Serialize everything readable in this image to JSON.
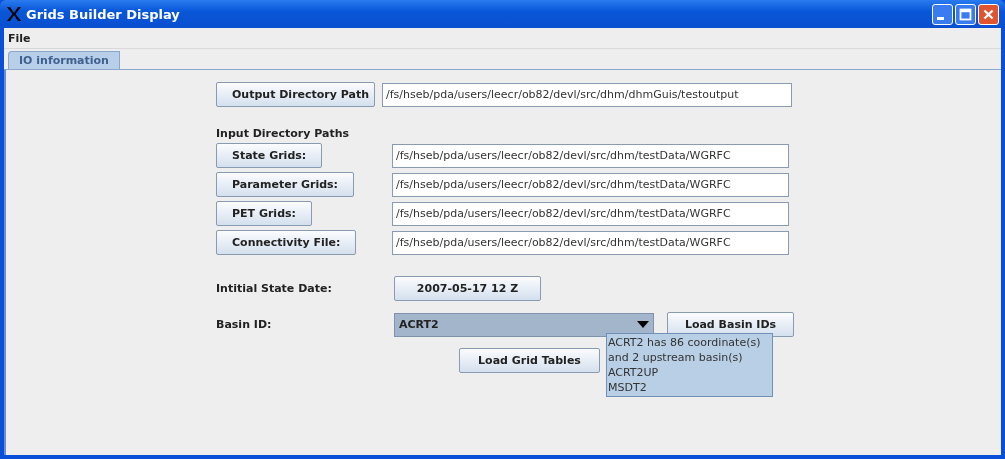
{
  "window": {
    "title": "Grids Builder Display"
  },
  "menu": [
    "File"
  ],
  "tabs": [
    {
      "label": "IO information",
      "selected": true
    }
  ],
  "output": {
    "button": "Output Directory Path",
    "value": "/fs/hseb/pda/users/leecr/ob82/devl/src/dhm/dhmGuis/testoutput"
  },
  "input_heading": "Input Directory Paths",
  "inputs": [
    {
      "button": "State Grids:",
      "value": "/fs/hseb/pda/users/leecr/ob82/devl/src/dhm/testData/WGRFC"
    },
    {
      "button": "Parameter Grids:",
      "value": "/fs/hseb/pda/users/leecr/ob82/devl/src/dhm/testData/WGRFC"
    },
    {
      "button": "PET Grids:",
      "value": "/fs/hseb/pda/users/leecr/ob82/devl/src/dhm/testData/WGRFC"
    },
    {
      "button": "Connectivity File:",
      "value": "/fs/hseb/pda/users/leecr/ob82/devl/src/dhm/testData/WGRFC"
    }
  ],
  "date": {
    "label": "Intitial State Date:",
    "button": "2007-05-17 12 Z"
  },
  "basin": {
    "label": "Basin ID:",
    "value": "ACRT2",
    "button": "Load Basin IDs"
  },
  "tooltip": [
    "ACRT2 has 86 coordinate(s)",
    "and 2 upstream basin(s)",
    "ACRT2UP",
    "MSDT2"
  ],
  "load_button": "Load Grid Tables"
}
